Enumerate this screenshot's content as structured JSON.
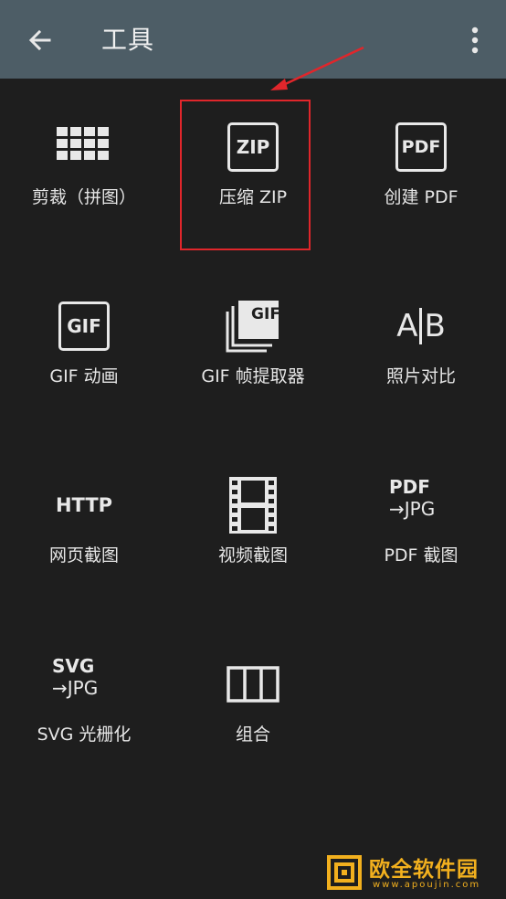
{
  "appbar": {
    "title": "工具",
    "back_icon": "arrow-back-icon",
    "menu_icon": "more-vert-icon"
  },
  "tools": [
    {
      "label": "剪裁（拼图）",
      "icon": "grid-icon"
    },
    {
      "label": "压缩 ZIP",
      "icon": "zip-icon",
      "icon_text": "ZIP"
    },
    {
      "label": "创建 PDF",
      "icon": "pdf-icon",
      "icon_text": "PDF"
    },
    {
      "label": "GIF 动画",
      "icon": "gif-icon",
      "icon_text": "GIF"
    },
    {
      "label": "GIF 帧提取器",
      "icon": "gif-frames-icon",
      "icon_text": "GIF"
    },
    {
      "label": "照片对比",
      "icon": "compare-icon",
      "icon_text_a": "A",
      "icon_text_b": "B"
    },
    {
      "label": "网页截图",
      "icon": "http-icon",
      "icon_text": "HTTP"
    },
    {
      "label": "视频截图",
      "icon": "film-icon"
    },
    {
      "label": "PDF 截图",
      "icon": "pdf-to-jpg-icon",
      "icon_line1": "PDF",
      "icon_line2": "→JPG"
    },
    {
      "label": "SVG 光栅化",
      "icon": "svg-to-jpg-icon",
      "icon_line1": "SVG",
      "icon_line2": "→JPG"
    },
    {
      "label": "组合",
      "icon": "columns-icon"
    }
  ],
  "watermark": {
    "name": "欧全软件园",
    "url": "www.apoujin.com"
  },
  "colors": {
    "appbar": "#4d5d66",
    "background": "#1e1e1e",
    "highlight": "#e0262b",
    "watermark": "#f2b01e"
  }
}
